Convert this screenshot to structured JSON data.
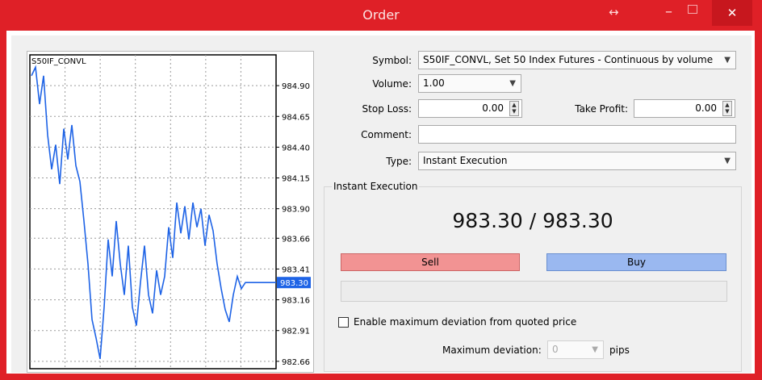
{
  "window": {
    "title": "Order",
    "close_glyph": "✕",
    "resize_glyph": "↔",
    "min_glyph": "–"
  },
  "form": {
    "symbol_label": "Symbol:",
    "symbol_value": "S50IF_CONVL, Set 50 Index Futures - Continuous  by volume",
    "volume_label": "Volume:",
    "volume_value": "1.00",
    "stop_loss_label": "Stop Loss:",
    "stop_loss_value": "0.00",
    "take_profit_label": "Take Profit:",
    "take_profit_value": "0.00",
    "comment_label": "Comment:",
    "comment_value": "",
    "type_label": "Type:",
    "type_value": "Instant Execution"
  },
  "execution": {
    "group_label": "Instant Execution",
    "quote": "983.30 / 983.30",
    "sell_label": "Sell",
    "buy_label": "Buy",
    "enable_deviation_label": "Enable maximum deviation from quoted price",
    "enable_deviation_checked": false,
    "max_deviation_label": "Maximum deviation:",
    "max_deviation_value": "0",
    "pips_label": "pips"
  },
  "chart_data": {
    "type": "line",
    "title": "S50IF_CONVL",
    "ylim": [
      982.6,
      985.15
    ],
    "yticks": [
      "984.90",
      "984.65",
      "984.40",
      "984.15",
      "983.90",
      "983.66",
      "983.41",
      "983.16",
      "982.91",
      "982.66"
    ],
    "current_price": "983.30",
    "line_color": "#1e63e6",
    "y": [
      984.98,
      985.05,
      984.75,
      984.98,
      984.5,
      984.22,
      984.42,
      984.1,
      984.55,
      984.3,
      984.58,
      984.25,
      984.12,
      983.8,
      983.45,
      983.0,
      982.85,
      982.68,
      983.1,
      983.65,
      983.35,
      983.8,
      983.45,
      983.2,
      983.6,
      983.1,
      982.95,
      983.3,
      983.6,
      983.2,
      983.05,
      983.4,
      983.2,
      983.35,
      983.75,
      983.5,
      983.95,
      983.7,
      983.92,
      983.65,
      983.95,
      983.75,
      983.9,
      983.6,
      983.85,
      983.72,
      983.45,
      983.25,
      983.08,
      982.98,
      983.2,
      983.35,
      983.25,
      983.3,
      983.3
    ]
  }
}
